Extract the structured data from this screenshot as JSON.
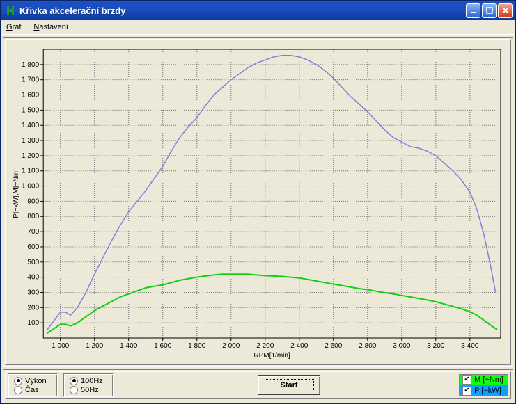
{
  "window": {
    "title": "Křivka akcelerační brzdy"
  },
  "menu": {
    "graf": "Graf",
    "nastaveni": "Nastavení"
  },
  "controls": {
    "vykon": "Výkon",
    "cas": "Čas",
    "hz100": "100Hz",
    "hz50": "50Hz",
    "start": "Start"
  },
  "legend": {
    "m": "M [~Nm]",
    "p": "P [~kW]",
    "m_color": "#10ff10",
    "p_color": "#10a0ff"
  },
  "chart_data": {
    "type": "line",
    "xlabel": "RPM[1/min]",
    "ylabel": "P[~kW],M[~Nm]",
    "xlim": [
      900,
      3580
    ],
    "ylim": [
      0,
      1900
    ],
    "x_ticks": [
      1000,
      1200,
      1400,
      1600,
      1800,
      2000,
      2200,
      2400,
      2600,
      2800,
      3000,
      3200,
      3400
    ],
    "y_ticks": [
      100,
      200,
      300,
      400,
      500,
      600,
      700,
      800,
      900,
      1000,
      1100,
      1200,
      1300,
      1400,
      1500,
      1600,
      1700,
      1800
    ],
    "series": [
      {
        "name": "M [~Nm]",
        "color": "#8080e0",
        "data": [
          [
            920,
            50
          ],
          [
            960,
            110
          ],
          [
            1000,
            170
          ],
          [
            1030,
            170
          ],
          [
            1060,
            150
          ],
          [
            1100,
            200
          ],
          [
            1150,
            300
          ],
          [
            1200,
            420
          ],
          [
            1250,
            530
          ],
          [
            1300,
            640
          ],
          [
            1350,
            740
          ],
          [
            1400,
            830
          ],
          [
            1450,
            900
          ],
          [
            1500,
            970
          ],
          [
            1550,
            1050
          ],
          [
            1600,
            1130
          ],
          [
            1650,
            1230
          ],
          [
            1700,
            1320
          ],
          [
            1750,
            1390
          ],
          [
            1800,
            1450
          ],
          [
            1850,
            1530
          ],
          [
            1900,
            1600
          ],
          [
            1950,
            1650
          ],
          [
            2000,
            1700
          ],
          [
            2050,
            1740
          ],
          [
            2100,
            1780
          ],
          [
            2150,
            1810
          ],
          [
            2200,
            1830
          ],
          [
            2250,
            1850
          ],
          [
            2300,
            1860
          ],
          [
            2350,
            1860
          ],
          [
            2400,
            1850
          ],
          [
            2450,
            1830
          ],
          [
            2500,
            1800
          ],
          [
            2550,
            1760
          ],
          [
            2600,
            1710
          ],
          [
            2650,
            1650
          ],
          [
            2700,
            1590
          ],
          [
            2750,
            1540
          ],
          [
            2800,
            1490
          ],
          [
            2850,
            1430
          ],
          [
            2900,
            1370
          ],
          [
            2950,
            1320
          ],
          [
            3000,
            1290
          ],
          [
            3050,
            1260
          ],
          [
            3100,
            1250
          ],
          [
            3150,
            1230
          ],
          [
            3200,
            1200
          ],
          [
            3250,
            1150
          ],
          [
            3300,
            1100
          ],
          [
            3350,
            1040
          ],
          [
            3400,
            960
          ],
          [
            3440,
            850
          ],
          [
            3480,
            690
          ],
          [
            3520,
            480
          ],
          [
            3550,
            300
          ]
        ]
      },
      {
        "name": "P [~kW]",
        "color": "#10d010",
        "data": [
          [
            920,
            30
          ],
          [
            960,
            60
          ],
          [
            1000,
            90
          ],
          [
            1030,
            90
          ],
          [
            1060,
            80
          ],
          [
            1100,
            100
          ],
          [
            1150,
            140
          ],
          [
            1200,
            180
          ],
          [
            1250,
            210
          ],
          [
            1300,
            240
          ],
          [
            1350,
            270
          ],
          [
            1400,
            290
          ],
          [
            1450,
            310
          ],
          [
            1500,
            330
          ],
          [
            1550,
            340
          ],
          [
            1600,
            350
          ],
          [
            1650,
            365
          ],
          [
            1700,
            380
          ],
          [
            1750,
            390
          ],
          [
            1800,
            400
          ],
          [
            1850,
            408
          ],
          [
            1900,
            415
          ],
          [
            1950,
            420
          ],
          [
            2000,
            420
          ],
          [
            2050,
            420
          ],
          [
            2100,
            420
          ],
          [
            2150,
            415
          ],
          [
            2200,
            410
          ],
          [
            2250,
            408
          ],
          [
            2300,
            405
          ],
          [
            2350,
            400
          ],
          [
            2400,
            395
          ],
          [
            2450,
            385
          ],
          [
            2500,
            375
          ],
          [
            2550,
            365
          ],
          [
            2600,
            355
          ],
          [
            2650,
            345
          ],
          [
            2700,
            335
          ],
          [
            2750,
            325
          ],
          [
            2800,
            318
          ],
          [
            2850,
            308
          ],
          [
            2900,
            298
          ],
          [
            2950,
            290
          ],
          [
            3000,
            280
          ],
          [
            3050,
            270
          ],
          [
            3100,
            260
          ],
          [
            3150,
            250
          ],
          [
            3200,
            238
          ],
          [
            3250,
            223
          ],
          [
            3300,
            208
          ],
          [
            3350,
            192
          ],
          [
            3400,
            172
          ],
          [
            3440,
            150
          ],
          [
            3480,
            118
          ],
          [
            3520,
            85
          ],
          [
            3560,
            55
          ]
        ]
      }
    ]
  }
}
